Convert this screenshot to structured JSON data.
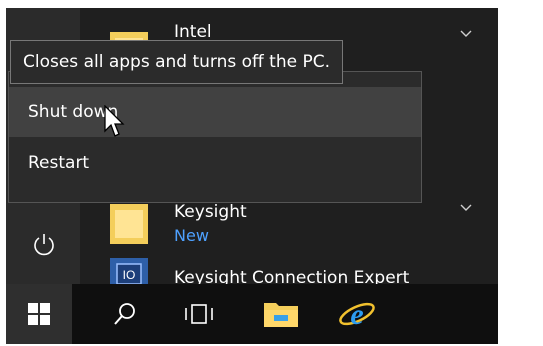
{
  "start_menu": {
    "apps": [
      {
        "label": "Intel",
        "sub": ""
      },
      {
        "label": "Keysight",
        "sub": "New"
      },
      {
        "label": "Keysight Connection Expert",
        "sub": ""
      }
    ]
  },
  "power_menu": {
    "tooltip": "Closes all apps and turns off the PC.",
    "items": [
      {
        "label": "Shut down",
        "hovered": true
      },
      {
        "label": "Restart",
        "hovered": false
      }
    ]
  },
  "taskbar": {
    "items": [
      "start-icon",
      "search-icon",
      "task-view-icon",
      "file-explorer-icon",
      "internet-explorer-icon"
    ]
  },
  "colors": {
    "menu_bg": "#2b2b2b",
    "hover_bg": "#414141",
    "accent_new": "#4ea1ff",
    "folder": "#f4ce5b"
  }
}
